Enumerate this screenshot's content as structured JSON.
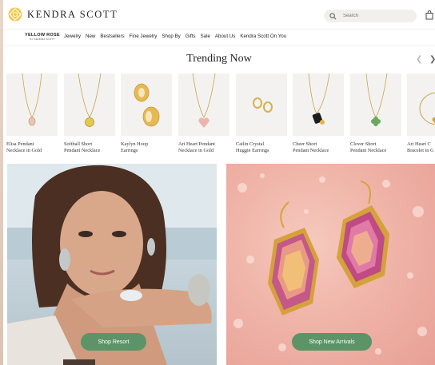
{
  "header": {
    "brand": "KENDRA SCOTT",
    "search_placeholder": "Search"
  },
  "nav": {
    "brand_main": "YELLOW ROSE",
    "brand_sub": "BY KENDRA SCOTT",
    "items": [
      "Jewelry",
      "New",
      "Bestsellers",
      "Fine Jewelry",
      "Shop By",
      "Gifts",
      "Sale",
      "About Us",
      "Kendra Scott On You"
    ]
  },
  "trending": {
    "title": "Trending Now",
    "products": [
      {
        "line1": "Elisa Pendant",
        "line2": "Necklace in Gold"
      },
      {
        "line1": "Softball Short",
        "line2": "Pendant Necklace"
      },
      {
        "line1": "Kaylyn Hoop",
        "line2": "Earrings"
      },
      {
        "line1": "Ari Heart Pendant",
        "line2": "Necklace in Gold"
      },
      {
        "line1": "Cailin Crystal",
        "line2": "Huggie Earrings"
      },
      {
        "line1": "Cheer Short",
        "line2": "Pendant Necklace"
      },
      {
        "line1": "Clover Short",
        "line2": "Pendant Necklace"
      },
      {
        "line1": "Ari Heart C",
        "line2": "Bracelet in G"
      }
    ]
  },
  "banners": {
    "left_button": "Shop Resort",
    "right_button": "Shop New Arrivals"
  },
  "colors": {
    "accent_green": "#5c9467",
    "logo_gold": "#f1c94b"
  }
}
